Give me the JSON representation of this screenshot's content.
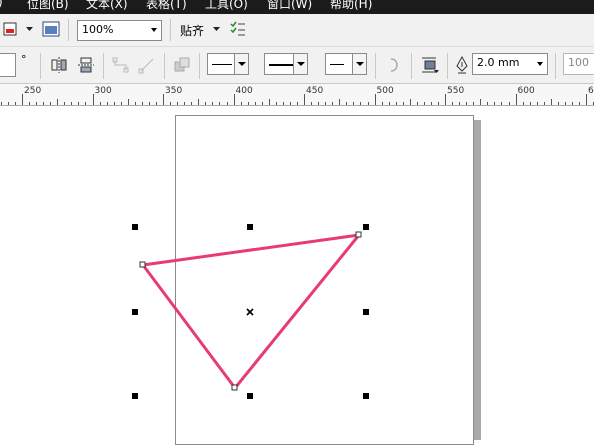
{
  "menu": [
    "位图(B)",
    "文本(X)",
    "表格(T)",
    "工具(O)",
    "窗口(W)",
    "帮助(H)"
  ],
  "toolbar": {
    "zoom_value": "100%",
    "snap_label": "贴齐"
  },
  "property_bar": {
    "degree_symbol": "°",
    "outline_width": "2.0 mm",
    "right_value": "100"
  },
  "ruler": {
    "labels": [
      "250",
      "300",
      "350",
      "400",
      "450",
      "500",
      "550",
      "600",
      "65"
    ]
  },
  "shape": {
    "type": "triangle",
    "stroke_color": "#e83a7a",
    "outline_width": "2.0 mm"
  }
}
